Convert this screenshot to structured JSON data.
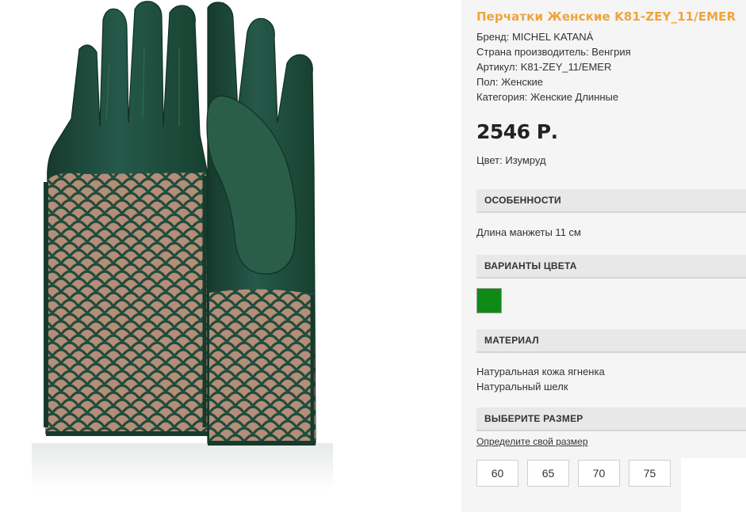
{
  "product": {
    "title": "Перчатки Женские K81-ZEY_11/EMER",
    "brand_line": "Бренд: MICHEL KATANÁ",
    "country_line": "Страна производитель: Венгрия",
    "article_line": "Артикул: K81-ZEY_11/EMER",
    "gender_line": "Пол: Женские",
    "category_line": "Категория: Женские Длинные",
    "price": "2546 Р.",
    "color_line": "Цвет: Изумруд"
  },
  "features": {
    "heading": "ОСОБЕННОСТИ",
    "text": "Длина манжеты 11 см"
  },
  "color_variants": {
    "heading": "ВАРИАНТЫ ЦВЕТА",
    "swatch_color": "#0f8a14"
  },
  "material": {
    "heading": "МАТЕРИАЛ",
    "lines": [
      "Натуральная кожа ягненка",
      "Натуральный шелк"
    ]
  },
  "size": {
    "heading": "ВЫБЕРИТЕ РАЗМЕР",
    "link_text": "Определите свой размер",
    "options": [
      "60",
      "65",
      "70",
      "75"
    ]
  },
  "colors": {
    "accent": "#f0a43c",
    "glove": "#1f4d3c",
    "lining": "#b58d78"
  }
}
